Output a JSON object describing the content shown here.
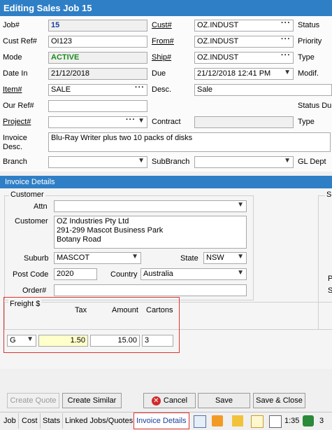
{
  "window": {
    "title": "Editing Sales Job 15"
  },
  "form": {
    "job_label": "Job#",
    "job_value": "15",
    "custref_label": "Cust Ref#",
    "custref_value": "OI123",
    "mode_label": "Mode",
    "mode_value": "ACTIVE",
    "datein_label": "Date In",
    "datein_value": "21/12/2018",
    "item_label": "Item#",
    "item_value": "SALE",
    "ourref_label": "Our Ref#",
    "ourref_value": "",
    "project_label": "Project#",
    "project_value": "",
    "invdesc_label_1": "Invoice",
    "invdesc_label_2": "Desc.",
    "invdesc_value": "Blu-Ray Writer plus two 10 packs of disks",
    "branch_label": "Branch",
    "branch_value": "",
    "cust_label": "Cust#",
    "cust_value": "OZ.INDUST",
    "from_label": "From#",
    "from_value": "OZ.INDUST",
    "ship_label": "Ship#",
    "ship_value": "OZ.INDUST",
    "due_label": "Due",
    "due_value": "21/12/2018 12:41 PM",
    "desc_label": "Desc.",
    "desc_value": "Sale",
    "contract_label": "Contract",
    "contract_value": "",
    "subbranch_label": "SubBranch",
    "subbranch_value": "",
    "status_label": "Status",
    "priority_label": "Priority",
    "type_label": "Type",
    "modif_label": "Modif.",
    "statusdu_label": "Status Du",
    "type2_label": "Type",
    "gldept_label": "GL Dept"
  },
  "invoice_details": {
    "section_title": "Invoice Details",
    "customer_group": "Customer",
    "attn_label": "Attn",
    "attn_value": "",
    "customer_label": "Customer",
    "address_lines": [
      "OZ Industries Pty Ltd",
      "291-299 Mascot Business Park",
      "Botany Road"
    ],
    "suburb_label": "Suburb",
    "suburb_value": "MASCOT",
    "state_label": "State",
    "state_value": "NSW",
    "postcode_label": "Post Code",
    "postcode_value": "2020",
    "country_label": "Country",
    "country_value": "Australia",
    "order_label": "Order#",
    "order_value": "",
    "right_group_partial": "Sl",
    "right_partial_1": "P",
    "right_partial_2": "S"
  },
  "freight": {
    "group_label": "Freight $",
    "tax_label": "Tax",
    "amount_label": "Amount",
    "cartons_label": "Cartons",
    "tax_code": "G",
    "tax_value": "1.50",
    "amount_value": "15.00",
    "cartons_value": "3"
  },
  "buttons": {
    "create_quote": "Create Quote",
    "create_similar": "Create Similar",
    "cancel": "Cancel",
    "save": "Save",
    "save_close": "Save & Close"
  },
  "tabs": [
    "Job",
    "Cost",
    "Stats",
    "Linked Jobs/Quotes",
    "Invoice Details"
  ],
  "statusbar": {
    "count_1": "1:35",
    "count_2": "3"
  },
  "colors": {
    "accent": "#2f7fc6",
    "active_text": "#1b8a1b",
    "highlight_border": "#dd3333"
  }
}
